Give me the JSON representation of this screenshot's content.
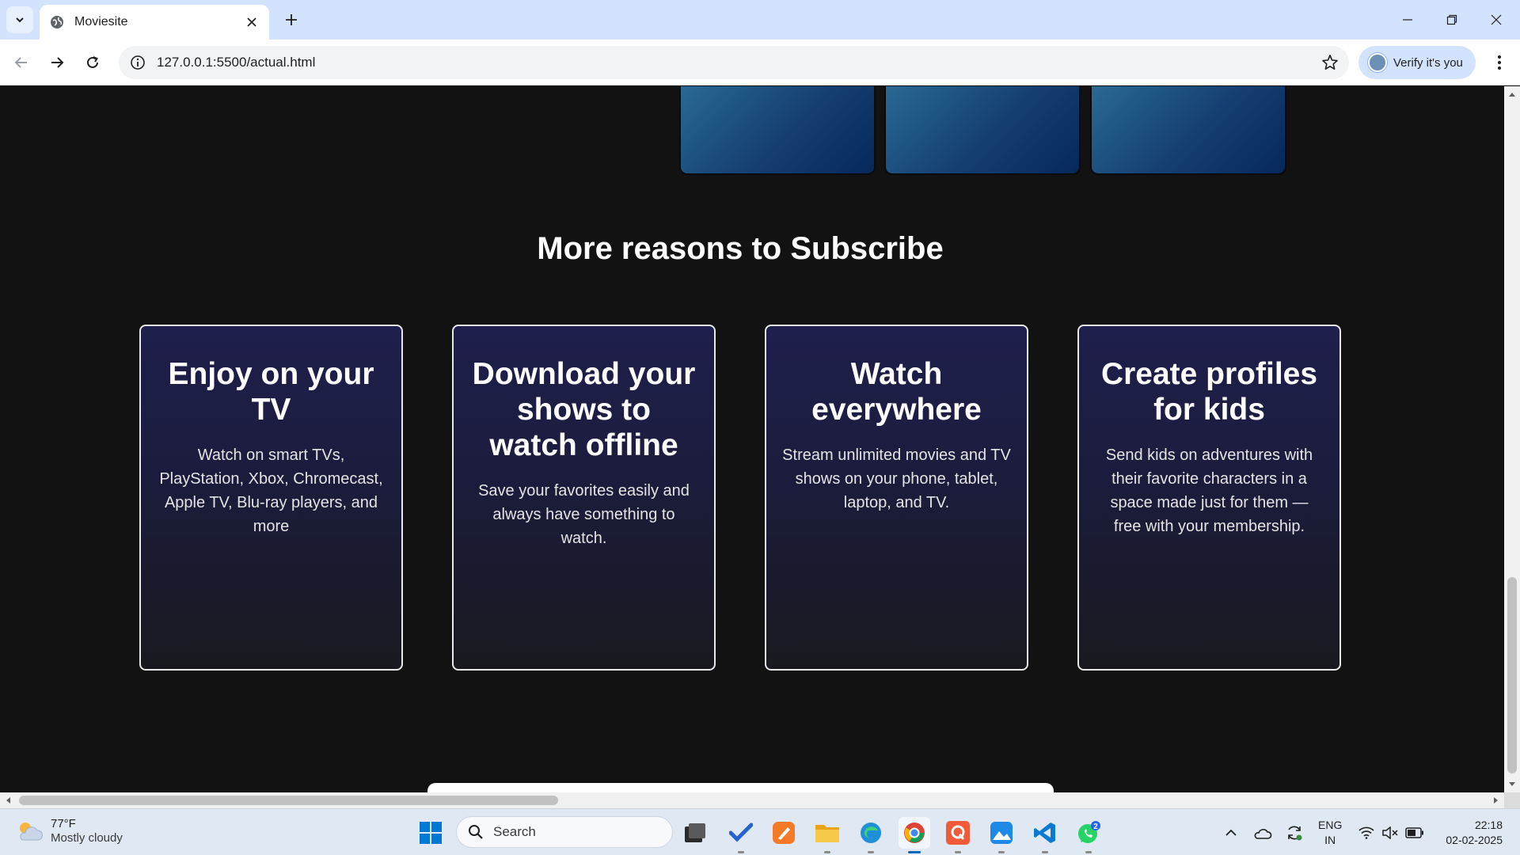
{
  "browser": {
    "tab_title": "Moviesite",
    "url": "127.0.0.1:5500/actual.html",
    "profile_label": "Verify it's you"
  },
  "page": {
    "heading": "More reasons to Subscribe",
    "cards": [
      {
        "title": "Enjoy on your TV",
        "text": "Watch on smart TVs, PlayStation, Xbox, Chromecast, Apple TV, Blu-ray players, and more"
      },
      {
        "title": "Download your shows to watch offline",
        "text": "Save your favorites easily and always have something to watch."
      },
      {
        "title": "Watch everywhere",
        "text": "Stream unlimited movies and TV shows on your phone, tablet, laptop, and TV."
      },
      {
        "title": "Create profiles for kids",
        "text": "Send kids on adventures with their favorite characters in a space made just for them — free with your membership."
      }
    ],
    "colors": {
      "background": "#121212",
      "card_top": "#1e1f4c",
      "card_bottom": "#19191f",
      "thumb_gradient_end": "#062859"
    }
  },
  "taskbar": {
    "weather": {
      "temp": "77°F",
      "condition": "Mostly cloudy"
    },
    "search_placeholder": "Search",
    "whatsapp_badge": "2",
    "language": {
      "line1": "ENG",
      "line2": "IN"
    },
    "clock": {
      "time": "22:18",
      "date": "02-02-2025"
    },
    "icons": [
      "windows-start-icon",
      "search-icon",
      "task-view-icon",
      "todo-icon",
      "paint-icon",
      "file-explorer-icon",
      "edge-icon",
      "chrome-icon",
      "app-q-icon",
      "photos-icon",
      "vscode-icon",
      "whatsapp-icon"
    ]
  }
}
